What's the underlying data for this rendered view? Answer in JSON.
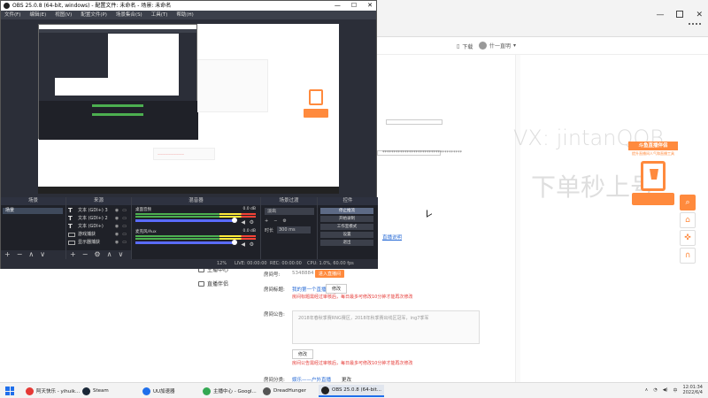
{
  "obs": {
    "title": "OBS 25.0.8 (64-bit, windows) - 配置文件: 未命名 - 场景: 未命名",
    "menu": [
      "文件(F)",
      "编辑(E)",
      "视图(V)",
      "配置文件(P)",
      "场景集合(S)",
      "工具(T)",
      "帮助(H)"
    ],
    "docks": {
      "scenes": {
        "title": "场景",
        "items": [
          "场景"
        ]
      },
      "sources": {
        "title": "来源",
        "items": [
          {
            "type": "text",
            "label": "文本 (GDI+) 3"
          },
          {
            "type": "text",
            "label": "文本 (GDI+) 2"
          },
          {
            "type": "text",
            "label": "文本 (GDI+)"
          },
          {
            "type": "monitor",
            "label": "游戏捕获"
          },
          {
            "type": "monitor",
            "label": "显示器捕获"
          }
        ]
      },
      "mixer": {
        "title": "混音器",
        "rows": [
          {
            "name": "桌面音频",
            "db": "0.0 dB"
          },
          {
            "name": "麦克风/Aux",
            "db": "0.0 dB"
          }
        ]
      },
      "transitions": {
        "title": "场景过渡",
        "selected": "淡出",
        "duration_label": "时长",
        "duration_value": "300 ms"
      },
      "controls": {
        "title": "控件",
        "buttons": [
          "停止推流",
          "开始录制",
          "工作室模式",
          "设置",
          "退出"
        ]
      }
    },
    "status": {
      "live": "LIVE: 00:00:00",
      "rec": "REC: 00:00:00",
      "cpu": "CPU: 1.0%, 60.00 fps",
      "dropped": "12%"
    }
  },
  "browser": {
    "header": {
      "download": "下载",
      "user": "什一直明"
    },
    "sidebar": [
      {
        "label": "主播中心"
      },
      {
        "label": "直播伴侣"
      }
    ],
    "form": {
      "room_label": "房间号:",
      "room_value": "5348884",
      "room_btn": "进入直播间",
      "title_label": "房间标题:",
      "title_value": "我的第一个直播",
      "title_edit": "修改",
      "title_note": "房间标题需经过审核后，每日最多可修改10分钟才能再次修改",
      "notice_label": "房间公告:",
      "notice_value": "2018年春秋季赛RNG赛区，2018年秋季赛出线区冠军，ing7季军",
      "notice_edit": "修改",
      "notice_note": "房间公告需经过审核后，每日最多可修改10分钟才能再次修改",
      "category_label": "房间分类:",
      "category_value": "娱乐——户外直播",
      "category_edit": "更改",
      "help_link": "直播说明"
    },
    "watermark": {
      "line1": "VX: jintanQQB",
      "line2": "下单秒上号"
    },
    "promo": {
      "head": "斗鱼直播伴侣",
      "sub": "提升直播间人气和直播工具"
    }
  },
  "taskbar": {
    "items": [
      {
        "label": "阿天快乐 - yihuik...",
        "color": "#e53935"
      },
      {
        "label": "Steam",
        "color": "#1b2838"
      },
      {
        "label": "UU加速器",
        "color": "#1f6feb"
      },
      {
        "label": "主播中心 - Googl...",
        "color": "#34a853"
      },
      {
        "label": "DreadHunger",
        "color": "#555"
      },
      {
        "label": "OBS 25.0.8 (64-bit...",
        "color": "#222"
      }
    ],
    "time": "12:01:34",
    "date": "2022/6/4"
  }
}
